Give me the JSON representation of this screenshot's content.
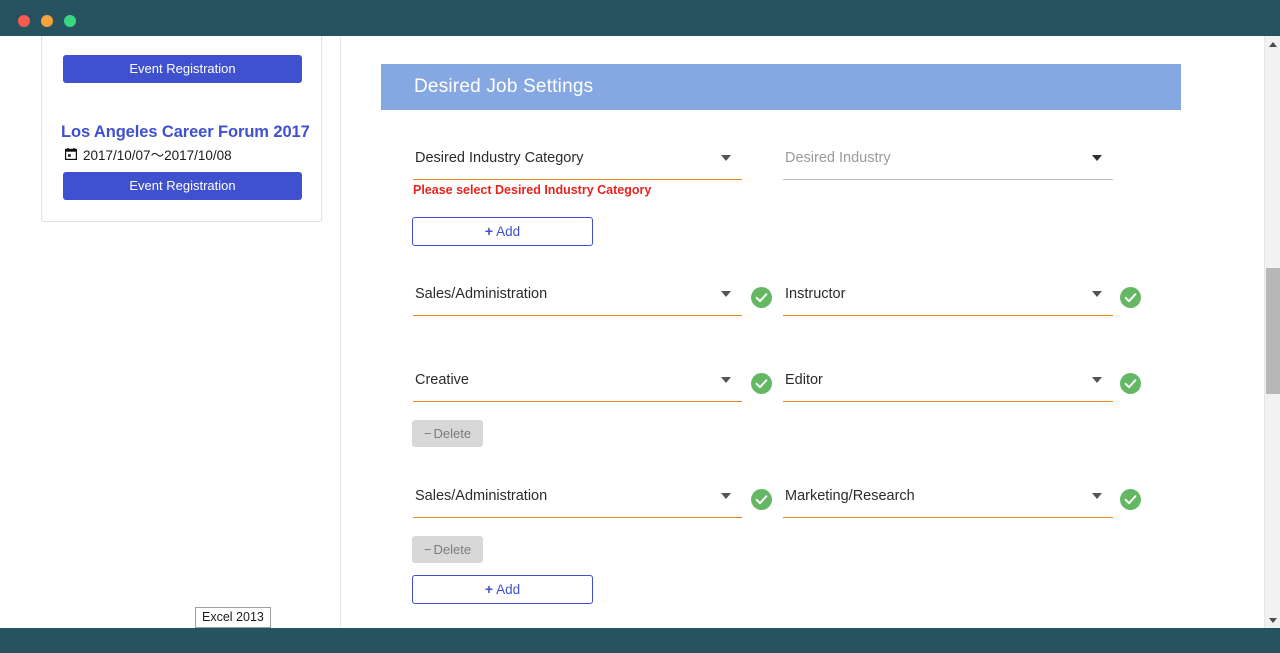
{
  "window": {
    "traffic_lights": [
      {
        "name": "close",
        "color": "#f95b51"
      },
      {
        "name": "minimize",
        "color": "#f6a33b"
      },
      {
        "name": "zoom",
        "color": "#3bd680"
      }
    ],
    "chrome_color": "#27525f"
  },
  "sidebar": {
    "event_card": {
      "top_register_button": "Event Registration",
      "event_title": "Los Angeles Career Forum 2017",
      "event_date": "2017/10/07〜2017/10/08",
      "calendar_icon": "calendar-icon",
      "bottom_register_button": "Event Registration",
      "title_color": "#3f51cf",
      "button_color": "#3f51cf"
    }
  },
  "main": {
    "section_title": "Desired Job Settings",
    "section_header_color": "#86a8e2",
    "rows": [
      {
        "category_value": "Desired Industry Category",
        "category_is_placeholder": false,
        "category_underline": "orange",
        "category_valid": false,
        "industry_value": "Desired Industry",
        "industry_is_placeholder": true,
        "industry_underline": "grey",
        "industry_valid": false,
        "error": "Please select Desired Industry Category",
        "action": "add",
        "action_label": "Add",
        "action_sign": "+"
      },
      {
        "category_value": "Sales/Administration",
        "category_is_placeholder": false,
        "category_underline": "orange",
        "category_valid": true,
        "industry_value": "Instructor",
        "industry_is_placeholder": false,
        "industry_underline": "orange",
        "industry_valid": true,
        "error": "",
        "action": "none",
        "action_label": "",
        "action_sign": ""
      },
      {
        "category_value": "Creative",
        "category_is_placeholder": false,
        "category_underline": "orange",
        "category_valid": true,
        "industry_value": "Editor",
        "industry_is_placeholder": false,
        "industry_underline": "orange",
        "industry_valid": true,
        "error": "",
        "action": "delete",
        "action_label": "Delete",
        "action_sign": "−"
      },
      {
        "category_value": "Sales/Administration",
        "category_is_placeholder": false,
        "category_underline": "orange",
        "category_valid": true,
        "industry_value": "Marketing/Research",
        "industry_is_placeholder": false,
        "industry_underline": "orange",
        "industry_valid": true,
        "error": "",
        "action": "delete",
        "action_label": "Delete",
        "action_sign": "−"
      }
    ],
    "final_add_button": {
      "label": "Add",
      "sign": "+"
    },
    "colors": {
      "underline_active": "#e8861e",
      "underline_inactive": "#bdbdbd",
      "error_text": "#e8241b",
      "valid_check": "#64b864",
      "add_button_border": "#4150d0",
      "delete_button_bg": "#d8d8d8"
    }
  },
  "tooltip": {
    "label": "Excel 2013"
  },
  "scrollbar": {
    "up_arrow_icon": "triangle-up-icon",
    "down_arrow_icon": "triangle-down-icon",
    "thumb_color": "#b8b8b8"
  }
}
